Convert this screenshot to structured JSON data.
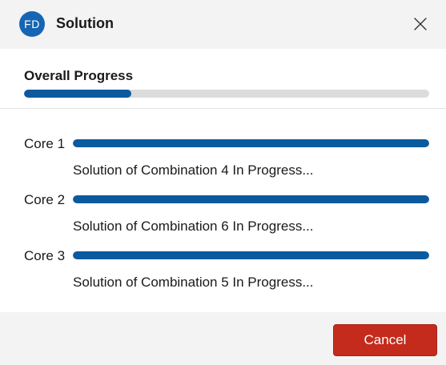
{
  "titlebar": {
    "app_icon_text": "FD",
    "title": "Solution",
    "close_icon": "close-icon"
  },
  "overall": {
    "label": "Overall Progress",
    "progress": 0.265
  },
  "cores": [
    {
      "label": "Core 1",
      "progress": 1.0,
      "status": "Solution of Combination 4 In Progress..."
    },
    {
      "label": "Core 2",
      "progress": 1.0,
      "status": "Solution of Combination 6 In Progress..."
    },
    {
      "label": "Core 3",
      "progress": 1.0,
      "status": "Solution of Combination 5 In Progress..."
    }
  ],
  "footer": {
    "cancel_label": "Cancel"
  },
  "colors": {
    "accent": "#0b5a9e",
    "app_icon": "#1565b4",
    "danger": "#c42b1c",
    "track": "#dcdcdc"
  }
}
